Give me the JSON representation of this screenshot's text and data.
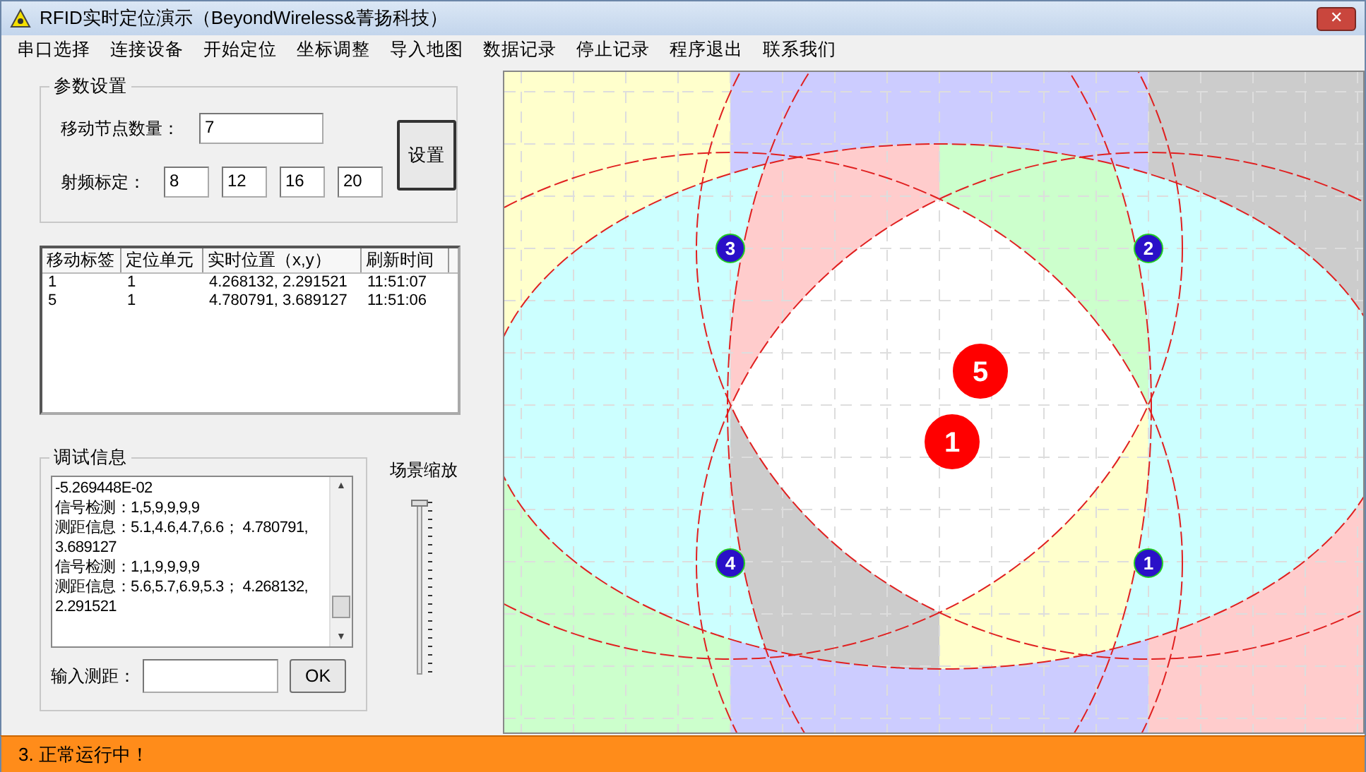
{
  "window": {
    "title": "RFID实时定位演示（BeyondWireless&菁扬科技）"
  },
  "menu": [
    "串口选择",
    "连接设备",
    "开始定位",
    "坐标调整",
    "导入地图",
    "数据记录",
    "停止记录",
    "程序退出",
    "联系我们"
  ],
  "params": {
    "title": "参数设置",
    "node_count_label": "移动节点数量：",
    "node_count": "7",
    "calibration_label": "射频标定：",
    "calibration": [
      "8",
      "12",
      "16",
      "20"
    ],
    "set_button": "设置"
  },
  "table": {
    "columns": [
      "移动标签",
      "定位单元",
      "实时位置（x,y）",
      "刷新时间"
    ],
    "rows": [
      [
        "1",
        "1",
        "4.268132, 2.291521",
        "11:51:07"
      ],
      [
        "5",
        "1",
        "4.780791, 3.689127",
        "11:51:06"
      ]
    ]
  },
  "debug": {
    "title": "调试信息",
    "lines": [
      "-5.269448E-02",
      "信号检测：1,5,9,9,9,9",
      "测距信息：5.1,4.6,4.7,6.6； 4.780791,",
      "3.689127",
      "信号检测：1,1,9,9,9,9",
      "测距信息：5.6,5.7,6.9,5.3； 4.268132,",
      "2.291521"
    ],
    "input_label": "输入测距：",
    "ok_button": "OK"
  },
  "zoom": {
    "label": "场景缩放",
    "level": 0
  },
  "map": {
    "anchors": [
      "3",
      "2",
      "4",
      "1"
    ],
    "tags": [
      "5",
      "1"
    ]
  },
  "status_bar": "3. 正常运行中！",
  "close_glyph": "✕",
  "scroll_arrows": [
    "▲",
    "▼"
  ]
}
